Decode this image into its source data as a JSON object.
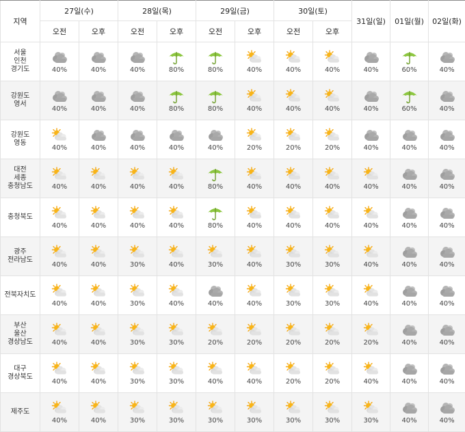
{
  "header": {
    "region_label": "지역",
    "day_columns": [
      {
        "label": "27일(수)",
        "am": "오전",
        "pm": "오후"
      },
      {
        "label": "28일(목)",
        "am": "오전",
        "pm": "오후"
      },
      {
        "label": "29일(금)",
        "am": "오전",
        "pm": "오후"
      },
      {
        "label": "30일(토)",
        "am": "오전",
        "pm": "오후"
      }
    ],
    "single_columns": [
      "31일(일)",
      "01일(월)",
      "02일(화)"
    ]
  },
  "icon_legend": {
    "cloud": "cloudy-icon",
    "sun": "partly-sunny-icon",
    "umbrella": "umbrella-rain-icon"
  },
  "colors": {
    "cloud": "#a9a9a9",
    "sun": "#f4a60f",
    "umbrella": "#8cc63f",
    "alt_row": "#f4f4f4"
  },
  "rows": [
    {
      "region": [
        "서울",
        "인천",
        "경기도"
      ],
      "cells": [
        {
          "icon": "cloud",
          "pct": "40%"
        },
        {
          "icon": "cloud",
          "pct": "40%"
        },
        {
          "icon": "cloud",
          "pct": "40%"
        },
        {
          "icon": "umbrella",
          "pct": "80%"
        },
        {
          "icon": "umbrella",
          "pct": "80%"
        },
        {
          "icon": "sun",
          "pct": "40%"
        },
        {
          "icon": "sun",
          "pct": "40%"
        },
        {
          "icon": "sun",
          "pct": "40%"
        },
        {
          "icon": "cloud",
          "pct": "40%"
        },
        {
          "icon": "umbrella",
          "pct": "60%"
        },
        {
          "icon": "cloud",
          "pct": "40%"
        }
      ]
    },
    {
      "region": [
        "강원도",
        "영서"
      ],
      "cells": [
        {
          "icon": "cloud",
          "pct": "40%"
        },
        {
          "icon": "cloud",
          "pct": "40%"
        },
        {
          "icon": "cloud",
          "pct": "40%"
        },
        {
          "icon": "umbrella",
          "pct": "80%"
        },
        {
          "icon": "umbrella",
          "pct": "80%"
        },
        {
          "icon": "sun",
          "pct": "40%"
        },
        {
          "icon": "sun",
          "pct": "40%"
        },
        {
          "icon": "sun",
          "pct": "40%"
        },
        {
          "icon": "cloud",
          "pct": "40%"
        },
        {
          "icon": "umbrella",
          "pct": "60%"
        },
        {
          "icon": "cloud",
          "pct": "40%"
        }
      ]
    },
    {
      "region": [
        "강원도",
        "영동"
      ],
      "cells": [
        {
          "icon": "sun",
          "pct": "40%"
        },
        {
          "icon": "cloud",
          "pct": "40%"
        },
        {
          "icon": "cloud",
          "pct": "40%"
        },
        {
          "icon": "cloud",
          "pct": "40%"
        },
        {
          "icon": "cloud",
          "pct": "40%"
        },
        {
          "icon": "sun",
          "pct": "20%"
        },
        {
          "icon": "sun",
          "pct": "20%"
        },
        {
          "icon": "sun",
          "pct": "20%"
        },
        {
          "icon": "cloud",
          "pct": "40%"
        },
        {
          "icon": "cloud",
          "pct": "40%"
        },
        {
          "icon": "cloud",
          "pct": "40%"
        }
      ]
    },
    {
      "region": [
        "대전",
        "세종",
        "충청남도"
      ],
      "cells": [
        {
          "icon": "sun",
          "pct": "40%"
        },
        {
          "icon": "sun",
          "pct": "40%"
        },
        {
          "icon": "sun",
          "pct": "40%"
        },
        {
          "icon": "sun",
          "pct": "40%"
        },
        {
          "icon": "umbrella",
          "pct": "80%"
        },
        {
          "icon": "sun",
          "pct": "40%"
        },
        {
          "icon": "sun",
          "pct": "40%"
        },
        {
          "icon": "sun",
          "pct": "40%"
        },
        {
          "icon": "sun",
          "pct": "40%"
        },
        {
          "icon": "cloud",
          "pct": "40%"
        },
        {
          "icon": "cloud",
          "pct": "40%"
        }
      ]
    },
    {
      "region": [
        "충청북도"
      ],
      "cells": [
        {
          "icon": "sun",
          "pct": "40%"
        },
        {
          "icon": "sun",
          "pct": "40%"
        },
        {
          "icon": "sun",
          "pct": "40%"
        },
        {
          "icon": "sun",
          "pct": "40%"
        },
        {
          "icon": "umbrella",
          "pct": "80%"
        },
        {
          "icon": "sun",
          "pct": "40%"
        },
        {
          "icon": "sun",
          "pct": "40%"
        },
        {
          "icon": "sun",
          "pct": "40%"
        },
        {
          "icon": "sun",
          "pct": "40%"
        },
        {
          "icon": "cloud",
          "pct": "40%"
        },
        {
          "icon": "cloud",
          "pct": "40%"
        }
      ]
    },
    {
      "region": [
        "광주",
        "전라남도"
      ],
      "cells": [
        {
          "icon": "sun",
          "pct": "40%"
        },
        {
          "icon": "sun",
          "pct": "40%"
        },
        {
          "icon": "sun",
          "pct": "30%"
        },
        {
          "icon": "sun",
          "pct": "40%"
        },
        {
          "icon": "sun",
          "pct": "30%"
        },
        {
          "icon": "sun",
          "pct": "40%"
        },
        {
          "icon": "sun",
          "pct": "30%"
        },
        {
          "icon": "sun",
          "pct": "30%"
        },
        {
          "icon": "sun",
          "pct": "40%"
        },
        {
          "icon": "cloud",
          "pct": "40%"
        },
        {
          "icon": "cloud",
          "pct": "40%"
        }
      ]
    },
    {
      "region": [
        "전북자치도"
      ],
      "cells": [
        {
          "icon": "sun",
          "pct": "40%"
        },
        {
          "icon": "sun",
          "pct": "40%"
        },
        {
          "icon": "sun",
          "pct": "30%"
        },
        {
          "icon": "sun",
          "pct": "40%"
        },
        {
          "icon": "cloud",
          "pct": "40%"
        },
        {
          "icon": "sun",
          "pct": "40%"
        },
        {
          "icon": "sun",
          "pct": "30%"
        },
        {
          "icon": "sun",
          "pct": "30%"
        },
        {
          "icon": "sun",
          "pct": "40%"
        },
        {
          "icon": "cloud",
          "pct": "40%"
        },
        {
          "icon": "cloud",
          "pct": "40%"
        }
      ]
    },
    {
      "region": [
        "부산",
        "울산",
        "경상남도"
      ],
      "cells": [
        {
          "icon": "sun",
          "pct": "40%"
        },
        {
          "icon": "sun",
          "pct": "40%"
        },
        {
          "icon": "sun",
          "pct": "30%"
        },
        {
          "icon": "sun",
          "pct": "30%"
        },
        {
          "icon": "sun",
          "pct": "20%"
        },
        {
          "icon": "sun",
          "pct": "20%"
        },
        {
          "icon": "sun",
          "pct": "20%"
        },
        {
          "icon": "sun",
          "pct": "20%"
        },
        {
          "icon": "sun",
          "pct": "20%"
        },
        {
          "icon": "cloud",
          "pct": "40%"
        },
        {
          "icon": "cloud",
          "pct": "40%"
        }
      ]
    },
    {
      "region": [
        "대구",
        "경상북도"
      ],
      "cells": [
        {
          "icon": "sun",
          "pct": "40%"
        },
        {
          "icon": "sun",
          "pct": "40%"
        },
        {
          "icon": "sun",
          "pct": "30%"
        },
        {
          "icon": "sun",
          "pct": "30%"
        },
        {
          "icon": "sun",
          "pct": "40%"
        },
        {
          "icon": "sun",
          "pct": "40%"
        },
        {
          "icon": "sun",
          "pct": "20%"
        },
        {
          "icon": "sun",
          "pct": "20%"
        },
        {
          "icon": "sun",
          "pct": "40%"
        },
        {
          "icon": "cloud",
          "pct": "40%"
        },
        {
          "icon": "cloud",
          "pct": "40%"
        }
      ]
    },
    {
      "region": [
        "제주도"
      ],
      "cells": [
        {
          "icon": "sun",
          "pct": "40%"
        },
        {
          "icon": "sun",
          "pct": "40%"
        },
        {
          "icon": "sun",
          "pct": "30%"
        },
        {
          "icon": "sun",
          "pct": "30%"
        },
        {
          "icon": "sun",
          "pct": "30%"
        },
        {
          "icon": "sun",
          "pct": "30%"
        },
        {
          "icon": "sun",
          "pct": "30%"
        },
        {
          "icon": "sun",
          "pct": "30%"
        },
        {
          "icon": "sun",
          "pct": "30%"
        },
        {
          "icon": "cloud",
          "pct": "40%"
        },
        {
          "icon": "cloud",
          "pct": "40%"
        }
      ]
    }
  ]
}
